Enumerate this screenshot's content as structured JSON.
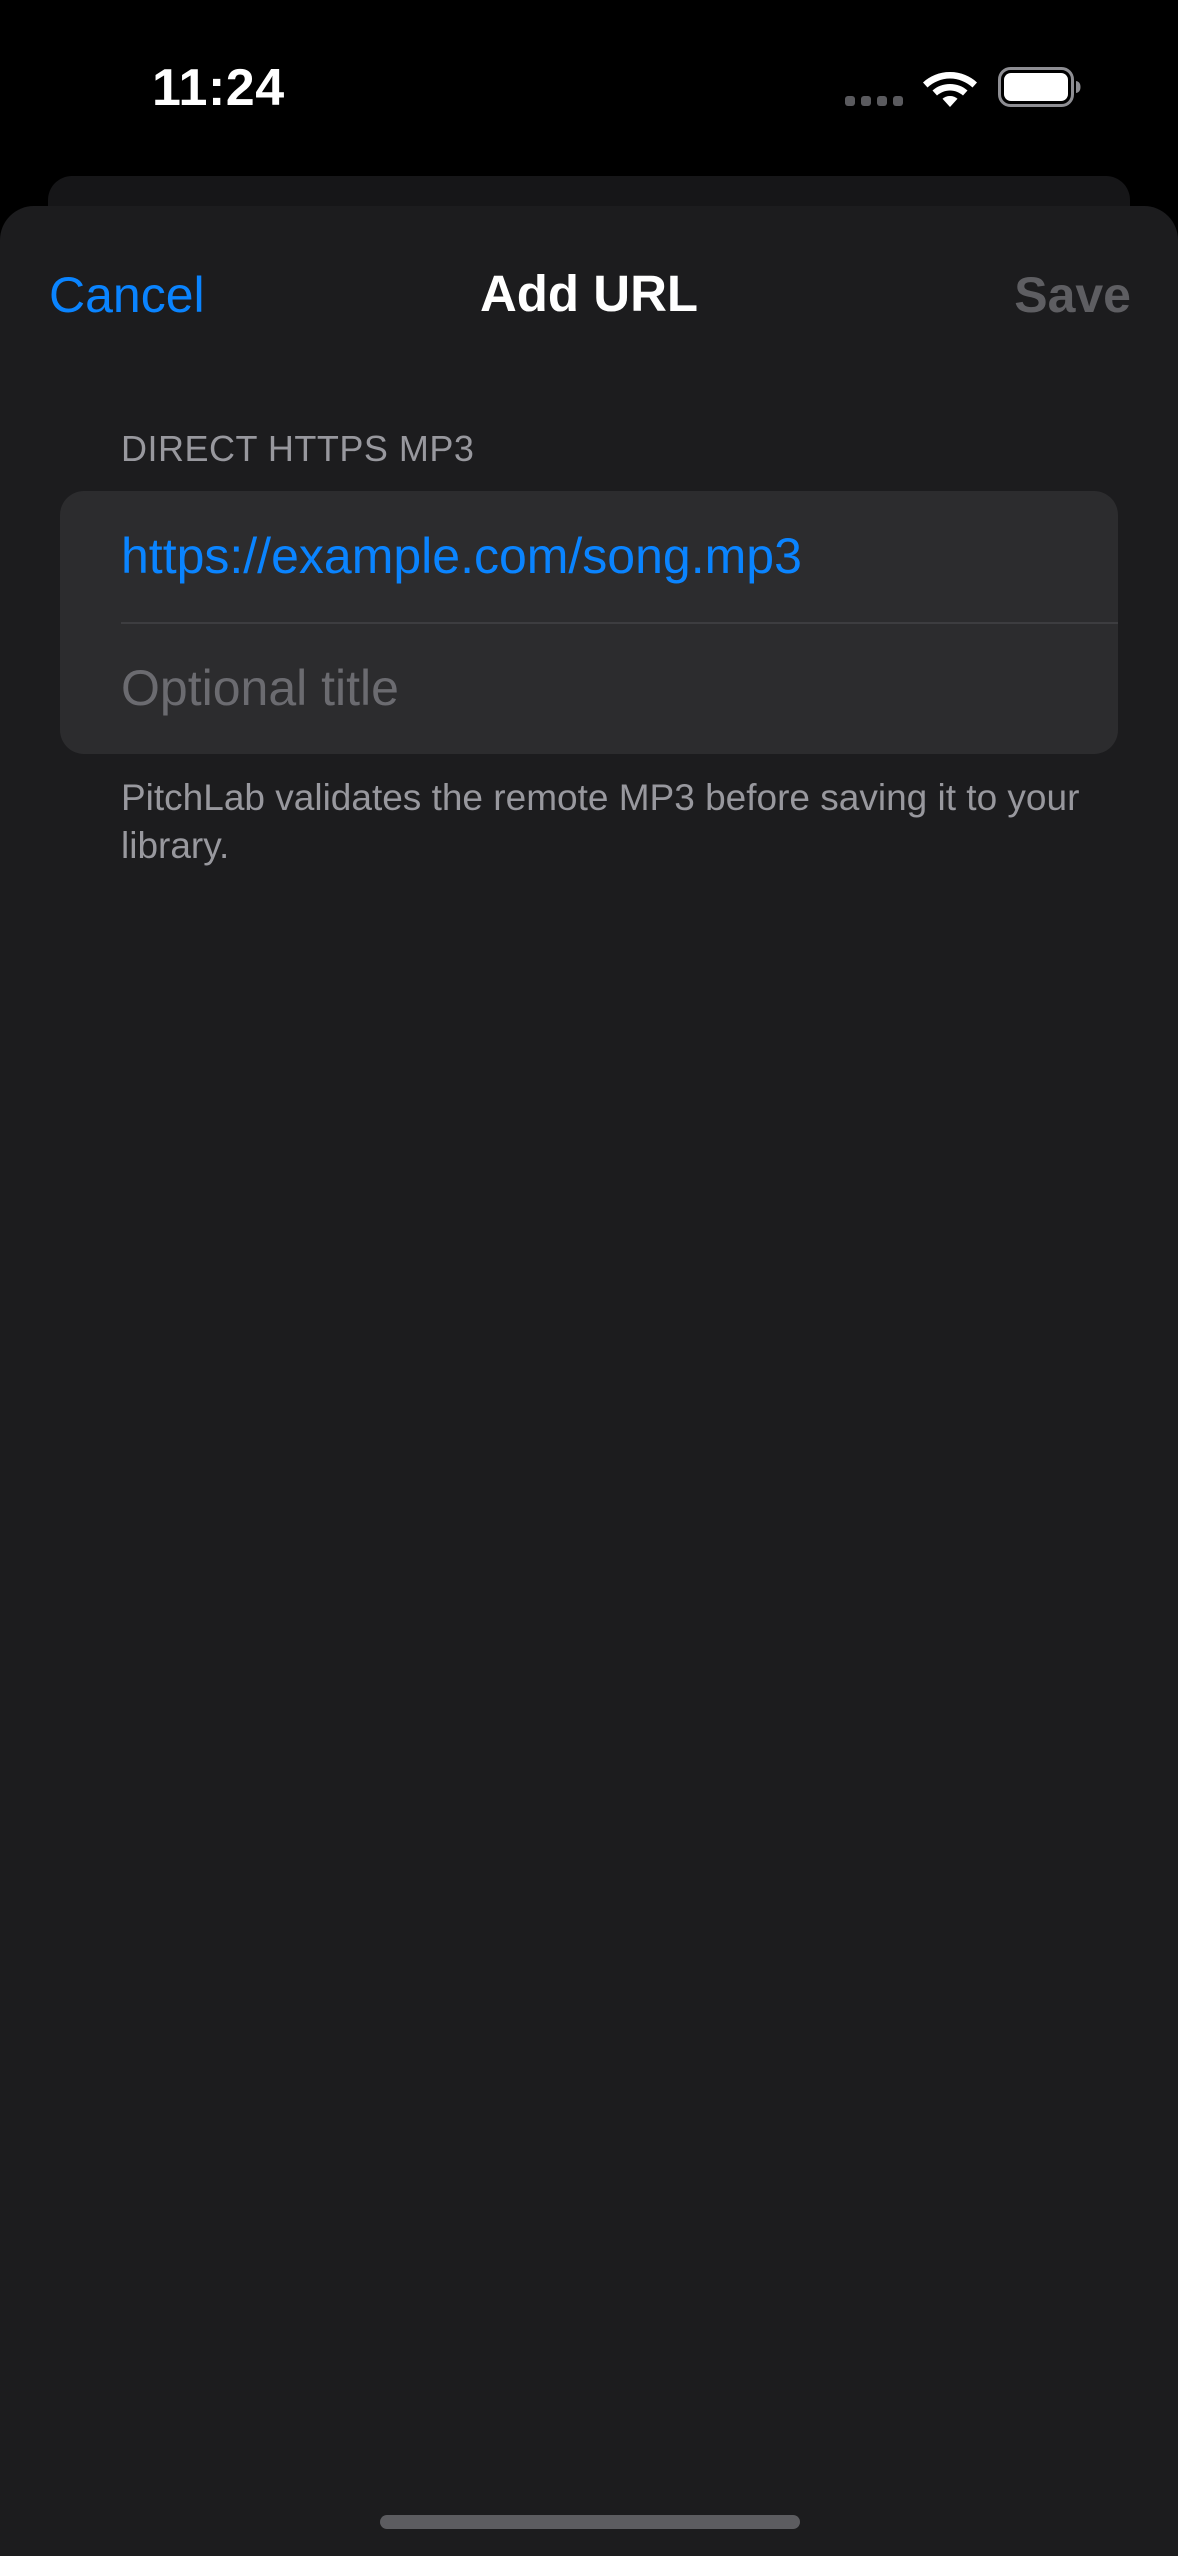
{
  "status_bar": {
    "time": "11:24",
    "icons": [
      "cellular-signal-icon",
      "wifi-icon",
      "battery-icon"
    ]
  },
  "nav": {
    "cancel_label": "Cancel",
    "title": "Add URL",
    "save_label": "Save"
  },
  "form": {
    "section_header": "DIRECT HTTPS MP3",
    "url_value": "https://example.com/song.mp3",
    "title_placeholder": "Optional title",
    "footer": "PitchLab validates the remote MP3 before saving it to your library."
  },
  "colors": {
    "accent": "#0a84ff",
    "sheet_background": "#1c1c1e",
    "group_background": "#2c2c2e",
    "disabled_text": "#5e5e62",
    "secondary_text": "#98989e"
  }
}
